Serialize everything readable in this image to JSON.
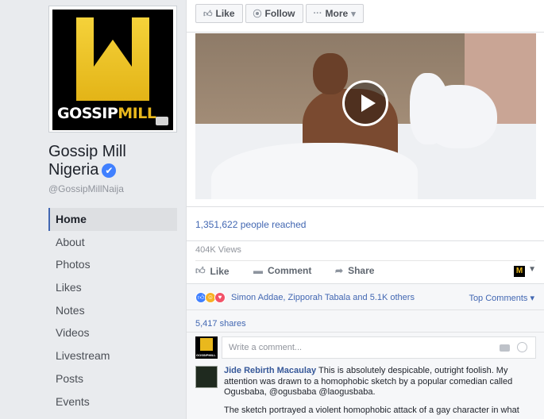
{
  "page": {
    "name_line1": "Gossip Mill",
    "name_line2": "Nigeria",
    "handle": "@GossipMillNaija",
    "logo_letter": "M",
    "logo_word1": "GOSSIP",
    "logo_word2": "MILL"
  },
  "nav": [
    {
      "label": "Home",
      "active": true
    },
    {
      "label": "About"
    },
    {
      "label": "Photos"
    },
    {
      "label": "Likes"
    },
    {
      "label": "Notes"
    },
    {
      "label": "Videos"
    },
    {
      "label": "Livestream"
    },
    {
      "label": "Posts"
    },
    {
      "label": "Events"
    }
  ],
  "header_buttons": {
    "like": "Like",
    "follow": "Follow",
    "more": "More"
  },
  "post": {
    "reached": "1,351,622 people reached",
    "views": "404K Views",
    "actions": {
      "like": "Like",
      "comment": "Comment",
      "share": "Share"
    },
    "reactions_text": "Simon Addae, Zipporah Tabala and 5.1K others",
    "top_comments": "Top Comments",
    "shares": "5,417 shares",
    "comment_placeholder": "Write a comment..."
  },
  "comment": {
    "author": "Jide Rebirth Macaulay",
    "text": "This is absolutely despicable, outright foolish. My attention was drawn to a homophobic sketch by a popular comedian called Ogusbaba, @ogusbaba @laogusbaba.",
    "text2": "The sketch portrayed a violent homophobic attack of a gay character in what"
  },
  "colors": {
    "link": "#4267b2",
    "logo_yellow": "#e9b81d",
    "background": "#e9ebee"
  }
}
